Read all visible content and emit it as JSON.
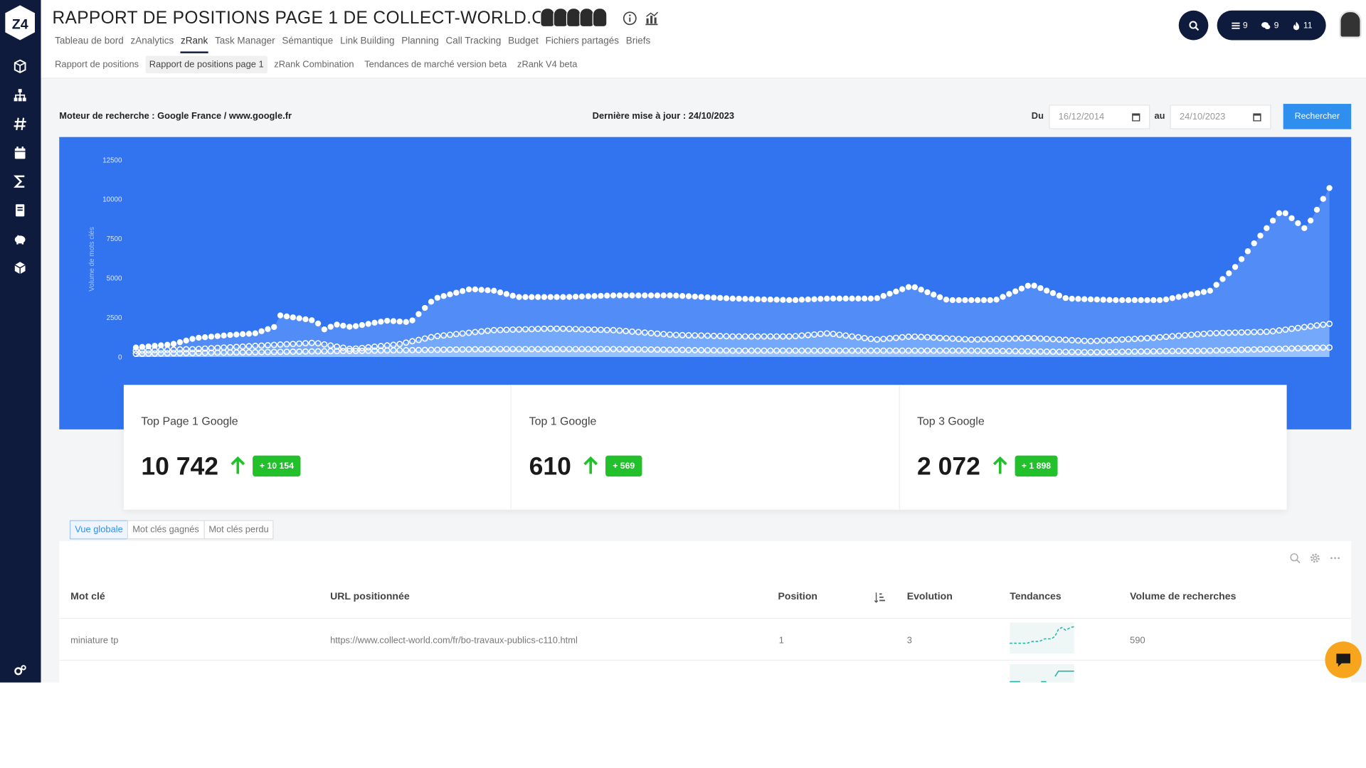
{
  "header": {
    "title": "RAPPORT DE POSITIONS PAGE 1 DE COLLECT-WORLD.COM",
    "main_nav": [
      "Tableau de bord",
      "zAnalytics",
      "zRank",
      "Task Manager",
      "Sémantique",
      "Link Building",
      "Planning",
      "Call Tracking",
      "Budget",
      "Fichiers partagés",
      "Briefs"
    ],
    "main_nav_active": "zRank",
    "sub_nav": [
      "Rapport de positions",
      "Rapport de positions page 1",
      "zRank Combination",
      "Tendances de marché version beta",
      "zRank V4 beta"
    ],
    "sub_nav_active": "Rapport de positions page 1",
    "counters": [
      {
        "icon": "list-icon",
        "value": "9"
      },
      {
        "icon": "chat-bubbles-icon",
        "value": "9"
      },
      {
        "icon": "flame-icon",
        "value": "11"
      }
    ]
  },
  "sidebar": {
    "logo_text": "Z4",
    "icons": [
      "cube-icon",
      "sitemap-icon",
      "hashtag-icon",
      "calendar-icon",
      "sigma-icon",
      "book-icon",
      "piggy-bank-icon",
      "box-icon",
      "settings-icon"
    ]
  },
  "filters": {
    "engine_label": "Moteur de recherche : Google France / www.google.fr",
    "last_update_label": "Dernière mise à jour : 24/10/2023",
    "from_label": "Du",
    "from_value": "16/12/2014",
    "to_label": "au",
    "to_value": "24/10/2023",
    "search_button": "Rechercher"
  },
  "chart_data": {
    "type": "area",
    "ylabel": "Volume de mots clés",
    "ylim": [
      0,
      12500
    ],
    "yticks": [
      "12500",
      "10000",
      "7500",
      "5000",
      "2500",
      "0"
    ],
    "grid": false,
    "series": [
      {
        "points": [
          [
            0,
            600
          ],
          [
            0.03,
            800
          ],
          [
            0.05,
            1200
          ],
          [
            0.08,
            1400
          ],
          [
            0.1,
            1500
          ],
          [
            0.12,
            2000
          ],
          [
            0.115,
            2700
          ],
          [
            0.15,
            2300
          ],
          [
            0.16,
            1600
          ],
          [
            0.165,
            2100
          ],
          [
            0.18,
            1900
          ],
          [
            0.21,
            2300
          ],
          [
            0.23,
            2200
          ],
          [
            0.25,
            3700
          ],
          [
            0.28,
            4300
          ],
          [
            0.3,
            4200
          ],
          [
            0.32,
            3800
          ],
          [
            0.36,
            3800
          ],
          [
            0.4,
            3900
          ],
          [
            0.45,
            3900
          ],
          [
            0.5,
            3700
          ],
          [
            0.55,
            3600
          ],
          [
            0.58,
            3700
          ],
          [
            0.62,
            3700
          ],
          [
            0.65,
            4500
          ],
          [
            0.68,
            3600
          ],
          [
            0.72,
            3600
          ],
          [
            0.75,
            4600
          ],
          [
            0.78,
            3700
          ],
          [
            0.82,
            3600
          ],
          [
            0.86,
            3600
          ],
          [
            0.9,
            4200
          ],
          [
            0.92,
            5600
          ],
          [
            0.94,
            7500
          ],
          [
            0.96,
            9300
          ],
          [
            0.98,
            8100
          ],
          [
            1.0,
            10700
          ]
        ]
      },
      {
        "points": [
          [
            0,
            400
          ],
          [
            0.05,
            500
          ],
          [
            0.1,
            700
          ],
          [
            0.15,
            900
          ],
          [
            0.18,
            500
          ],
          [
            0.22,
            800
          ],
          [
            0.25,
            1300
          ],
          [
            0.3,
            1700
          ],
          [
            0.35,
            1800
          ],
          [
            0.4,
            1700
          ],
          [
            0.45,
            1400
          ],
          [
            0.5,
            1300
          ],
          [
            0.55,
            1300
          ],
          [
            0.58,
            1500
          ],
          [
            0.62,
            1100
          ],
          [
            0.65,
            1300
          ],
          [
            0.7,
            1100
          ],
          [
            0.75,
            1200
          ],
          [
            0.8,
            1000
          ],
          [
            0.85,
            1200
          ],
          [
            0.9,
            1500
          ],
          [
            0.95,
            1600
          ],
          [
            1.0,
            2100
          ]
        ]
      },
      {
        "points": [
          [
            0,
            200
          ],
          [
            0.1,
            300
          ],
          [
            0.2,
            400
          ],
          [
            0.3,
            500
          ],
          [
            0.4,
            500
          ],
          [
            0.5,
            400
          ],
          [
            0.6,
            400
          ],
          [
            0.7,
            400
          ],
          [
            0.8,
            300
          ],
          [
            0.9,
            400
          ],
          [
            1.0,
            600
          ]
        ]
      }
    ]
  },
  "kpis": [
    {
      "title": "Top Page 1 Google",
      "value": "10 742",
      "delta": "+ 10 154"
    },
    {
      "title": "Top 1 Google",
      "value": "610",
      "delta": "+ 569"
    },
    {
      "title": "Top 3 Google",
      "value": "2 072",
      "delta": "+ 1 898"
    }
  ],
  "view_tabs": [
    "Vue globale",
    "Mot clés gagnés",
    "Mot clés perdu"
  ],
  "table": {
    "columns": [
      "Mot clé",
      "URL positionnée",
      "Position",
      "Evolution",
      "Tendances",
      "Volume de recherches"
    ],
    "rows": [
      {
        "keyword": "miniature tp",
        "url": "https://www.collect-world.com/fr/bo-travaux-publics-c110.html",
        "position": "1",
        "evolution": "3",
        "volume": "590"
      }
    ]
  }
}
